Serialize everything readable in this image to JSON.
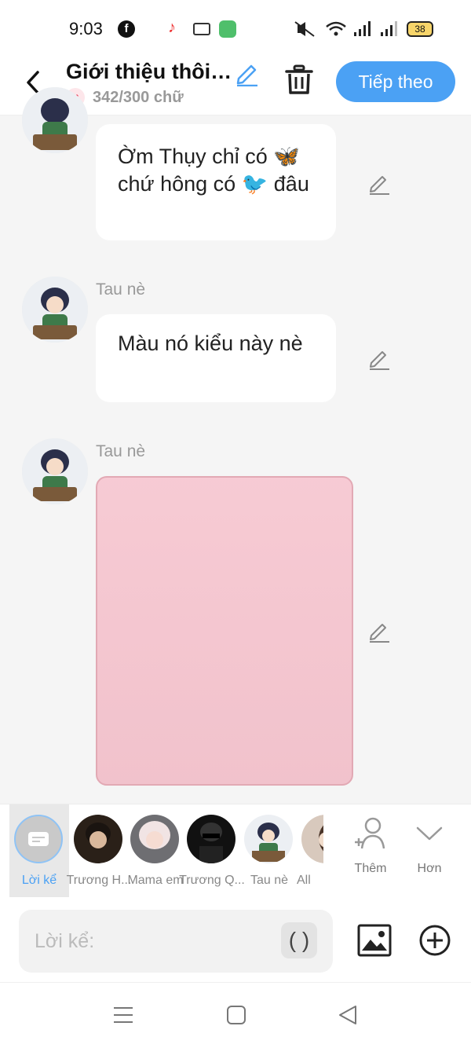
{
  "status": {
    "time": "9:03",
    "battery": "38"
  },
  "header": {
    "title": "Giới thiệu thôi…",
    "count": "342/300 chữ",
    "next_label": "Tiếp theo"
  },
  "messages": [
    {
      "sender": "",
      "text": "Ờm Thụy chỉ có 🦋 chứ hông có 🐦 đâu"
    },
    {
      "sender": "Tau nè",
      "text": "Màu nó kiểu này nè"
    },
    {
      "sender": "Tau nè",
      "image_color": "#f6c6d0"
    }
  ],
  "characters": [
    {
      "label": "Lời kể"
    },
    {
      "label": "Trương H..."
    },
    {
      "label": "Mama em"
    },
    {
      "label": "Trương Q..."
    },
    {
      "label": "Tau nè"
    },
    {
      "label": "All"
    }
  ],
  "actions": {
    "add_label": "Thêm",
    "more_label": "Hơn"
  },
  "input": {
    "placeholder": "Lời kể:",
    "paren_label": "( )"
  },
  "colors": {
    "accent": "#4ba1f4",
    "bubble": "#ffffff",
    "background": "#f5f5f5"
  }
}
